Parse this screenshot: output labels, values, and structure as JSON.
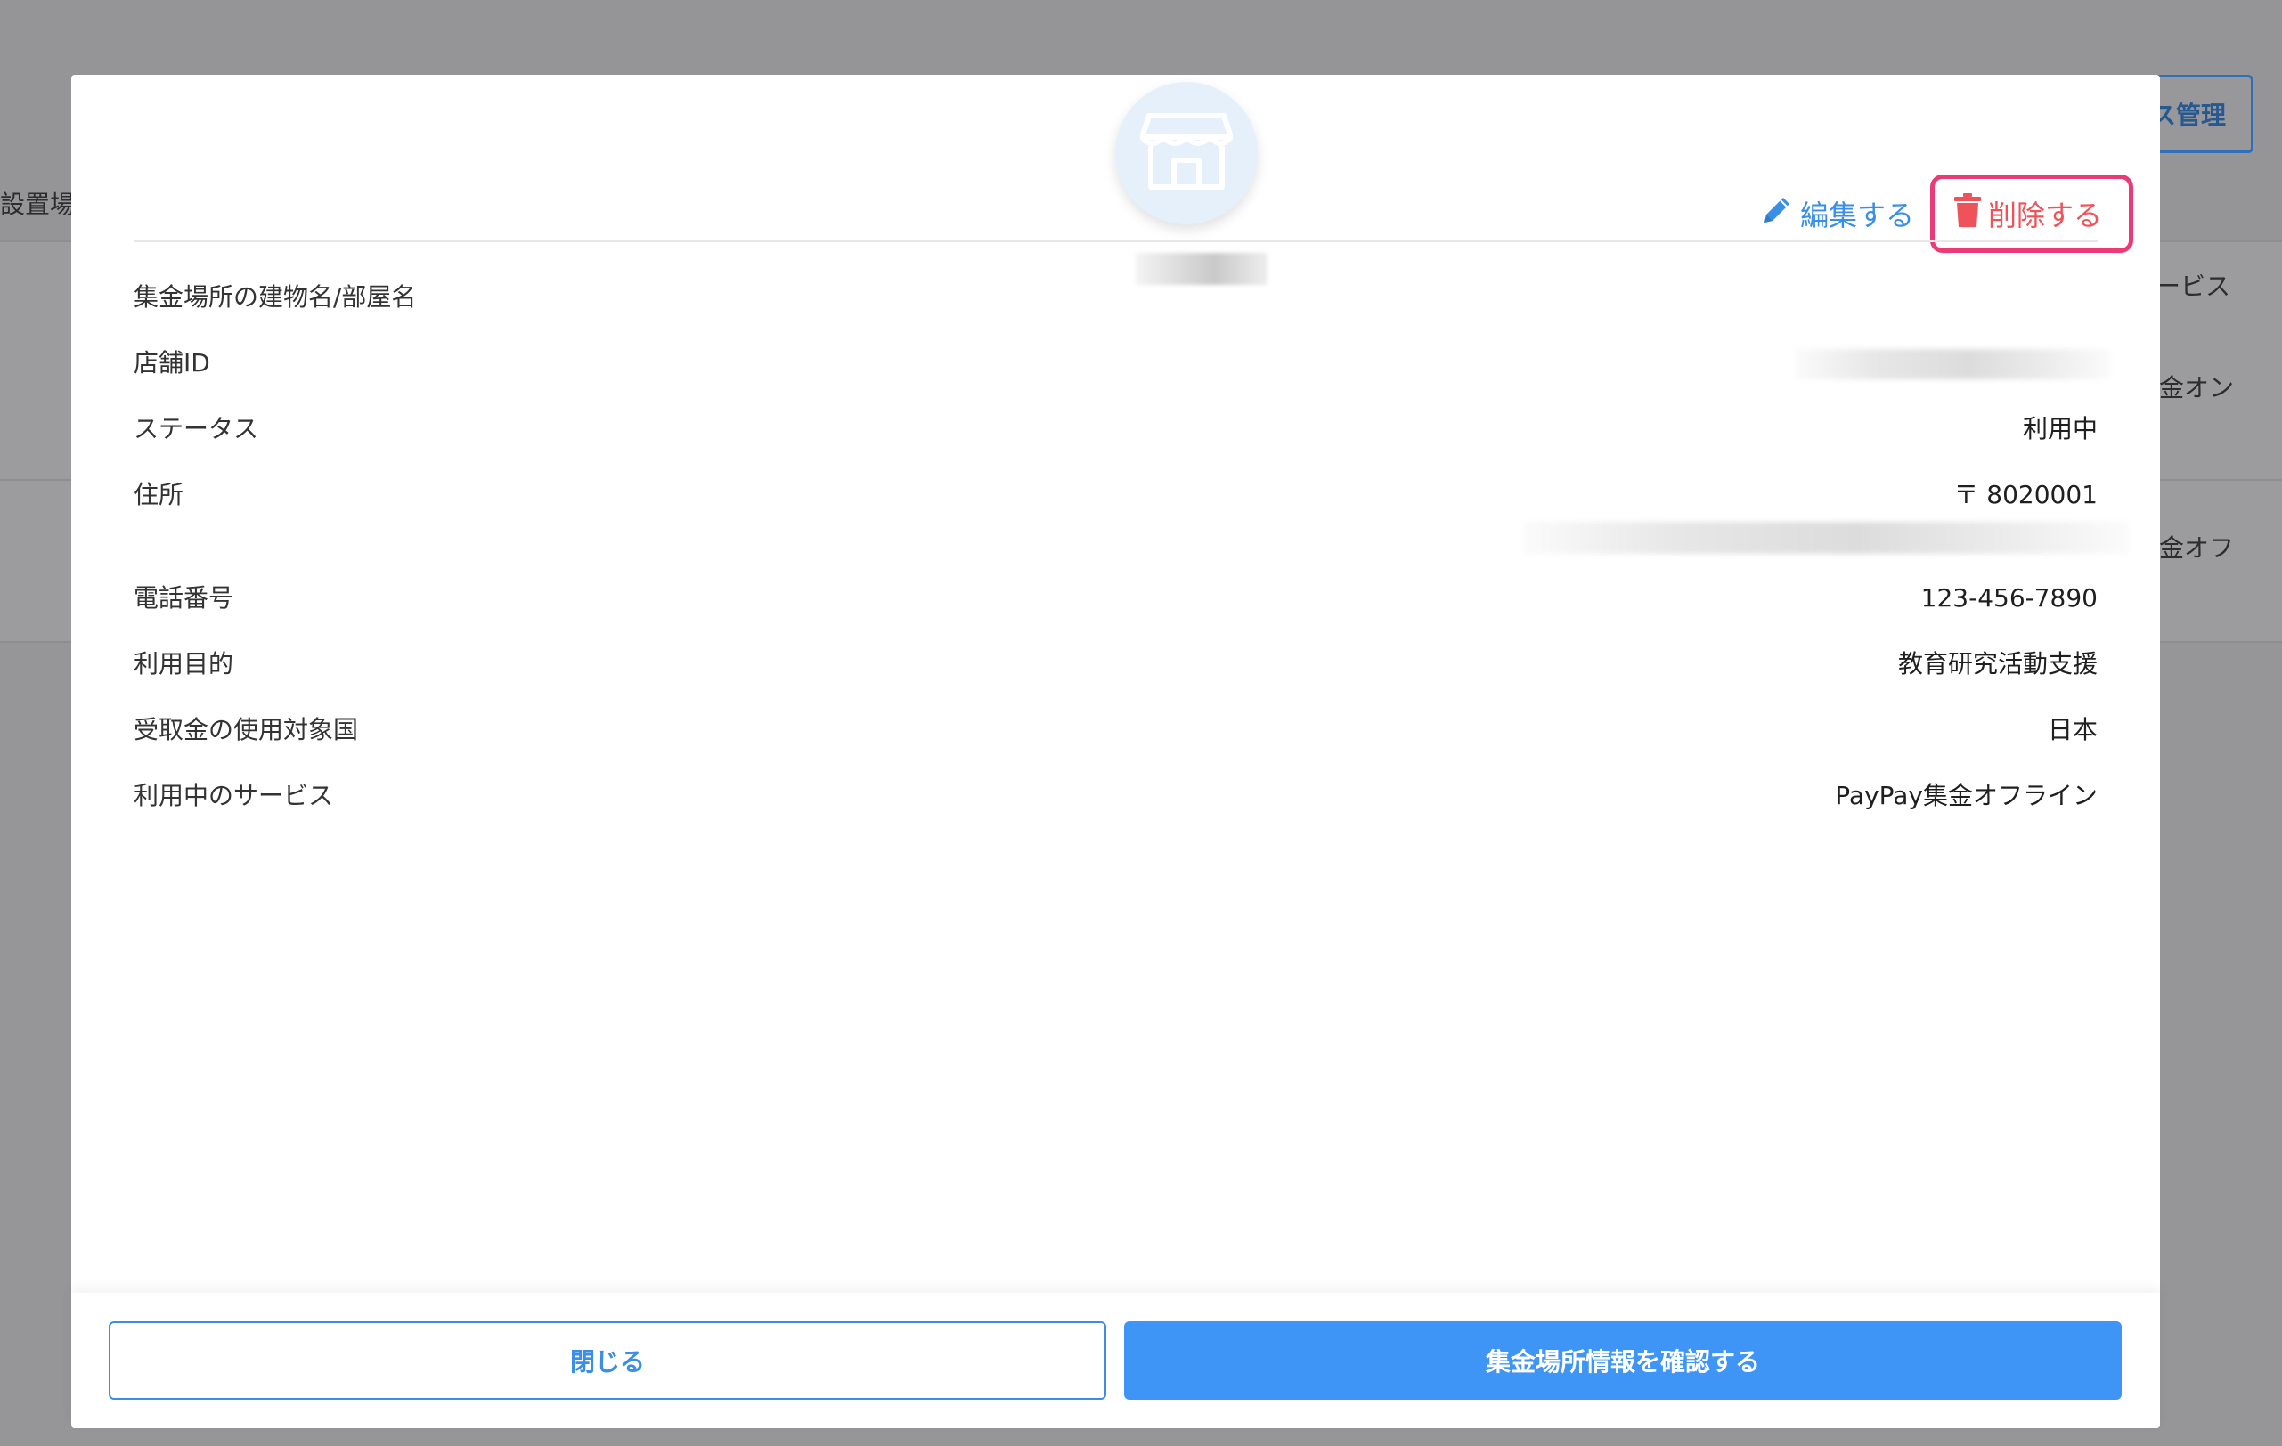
{
  "background": {
    "manage_label": "ス管理",
    "location_label": "設置場",
    "service_header": "ービス",
    "service_online": "金オン",
    "service_offline": "金オフ"
  },
  "modal": {
    "edit_label": "編集する",
    "delete_label": "削除する",
    "fields": {
      "building": {
        "label": "集金場所の建物名/部屋名",
        "value": ""
      },
      "store_id": {
        "label": "店舗ID"
      },
      "status": {
        "label": "ステータス",
        "value": "利用中"
      },
      "address": {
        "label": "住所",
        "postal": "〒 8020001"
      },
      "phone": {
        "label": "電話番号",
        "value": "123-456-7890"
      },
      "purpose": {
        "label": "利用目的",
        "value": "教育研究活動支援"
      },
      "country": {
        "label": "受取金の使用対象国",
        "value": "日本"
      },
      "service": {
        "label": "利用中のサービス",
        "value": "PayPay集金オフライン"
      }
    },
    "footer": {
      "close_label": "閉じる",
      "confirm_label": "集金場所情報を確認する"
    }
  },
  "colors": {
    "accent": "#3a8ee6",
    "primary_button": "#3e95f5",
    "delete": "#f0525a",
    "highlight_border": "#ec3a78",
    "overlay": "#969698"
  },
  "icons": {
    "avatar": "store-icon",
    "edit": "pencil-icon",
    "delete": "trash-icon"
  }
}
